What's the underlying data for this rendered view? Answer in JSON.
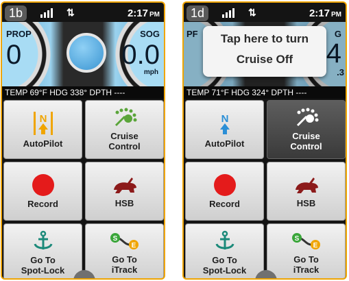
{
  "screens": [
    {
      "label": "1b",
      "time": "2:17",
      "ampm": "PM",
      "left_gauge": {
        "label": "PROP",
        "value": "0"
      },
      "right_gauge": {
        "label": "SOG",
        "value": "0.0",
        "unit": "mph"
      },
      "info_bar": "TEMP 69°F  HDG 338°  DPTH  ----",
      "tiles": {
        "autopilot": "AutoPilot",
        "cruise": "Cruise\nControl",
        "record": "Record",
        "hsb": "HSB",
        "spotlock": "Go To\nSpot-Lock",
        "itrack": "Go To\niTrack"
      }
    },
    {
      "label": "1d",
      "time": "2:17",
      "ampm": "PM",
      "left_gauge_partial_label": "PF",
      "right_gauge_partial_label": "G",
      "right_gauge_partial_value": "4",
      "right_gauge_partial_decimal": ".3",
      "popup": {
        "line1": "Tap here to turn",
        "line2": "Cruise Off"
      },
      "info_bar": "TEMP 71°F  HDG 324°  DPTH  ----",
      "tiles": {
        "autopilot": "AutoPilot",
        "cruise": "Cruise\nControl",
        "record": "Record",
        "hsb": "HSB",
        "spotlock": "Go To\nSpot-Lock",
        "itrack": "Go To\niTrack"
      }
    }
  ],
  "colors": {
    "frame": "#f0a500",
    "record": "#e41b1b",
    "hsb": "#8c1a1a",
    "cruise_icon": "#5aa53a",
    "anchor": "#1c8a7a",
    "autopilot_inactive": "#f0a500",
    "autopilot_active": "#2b8fd6"
  },
  "icons": [
    "signal-bars-icon",
    "data-arrows-icon",
    "autopilot-icon",
    "cruise-control-icon",
    "record-icon",
    "rabbit-icon",
    "anchor-icon",
    "itrack-icon",
    "chevron-down-icon"
  ]
}
